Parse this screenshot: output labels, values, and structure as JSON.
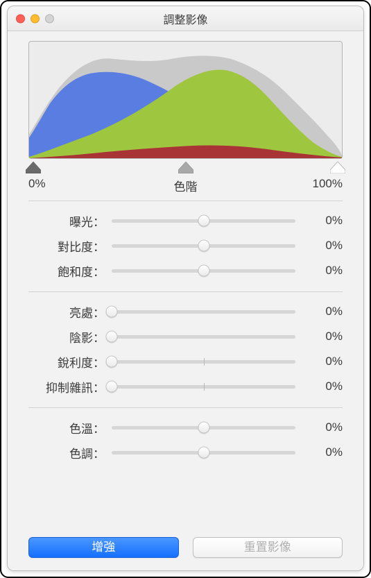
{
  "window": {
    "title": "調整影像"
  },
  "levels": {
    "left_label": "0%",
    "center_label": "色階",
    "right_label": "100%",
    "black_point": 0,
    "mid_point": 50,
    "white_point": 100
  },
  "groups": [
    {
      "sliders": [
        {
          "label": "曝光：",
          "value_text": "0%",
          "position": 50,
          "has_center_tick": true
        },
        {
          "label": "對比度：",
          "value_text": "0%",
          "position": 50,
          "has_center_tick": true
        },
        {
          "label": "飽和度：",
          "value_text": "0%",
          "position": 50,
          "has_center_tick": true
        }
      ]
    },
    {
      "sliders": [
        {
          "label": "亮處：",
          "value_text": "0%",
          "position": 0,
          "has_center_tick": false
        },
        {
          "label": "陰影：",
          "value_text": "0%",
          "position": 0,
          "has_center_tick": false
        },
        {
          "label": "銳利度：",
          "value_text": "0%",
          "position": 0,
          "has_center_tick": true
        },
        {
          "label": "抑制雜訊：",
          "value_text": "0%",
          "position": 0,
          "has_center_tick": true
        }
      ]
    },
    {
      "sliders": [
        {
          "label": "色溫：",
          "value_text": "0%",
          "position": 50,
          "has_center_tick": true
        },
        {
          "label": "色調：",
          "value_text": "0%",
          "position": 50,
          "has_center_tick": true
        }
      ]
    }
  ],
  "buttons": {
    "enhance": "增強",
    "reset": "重置影像"
  }
}
